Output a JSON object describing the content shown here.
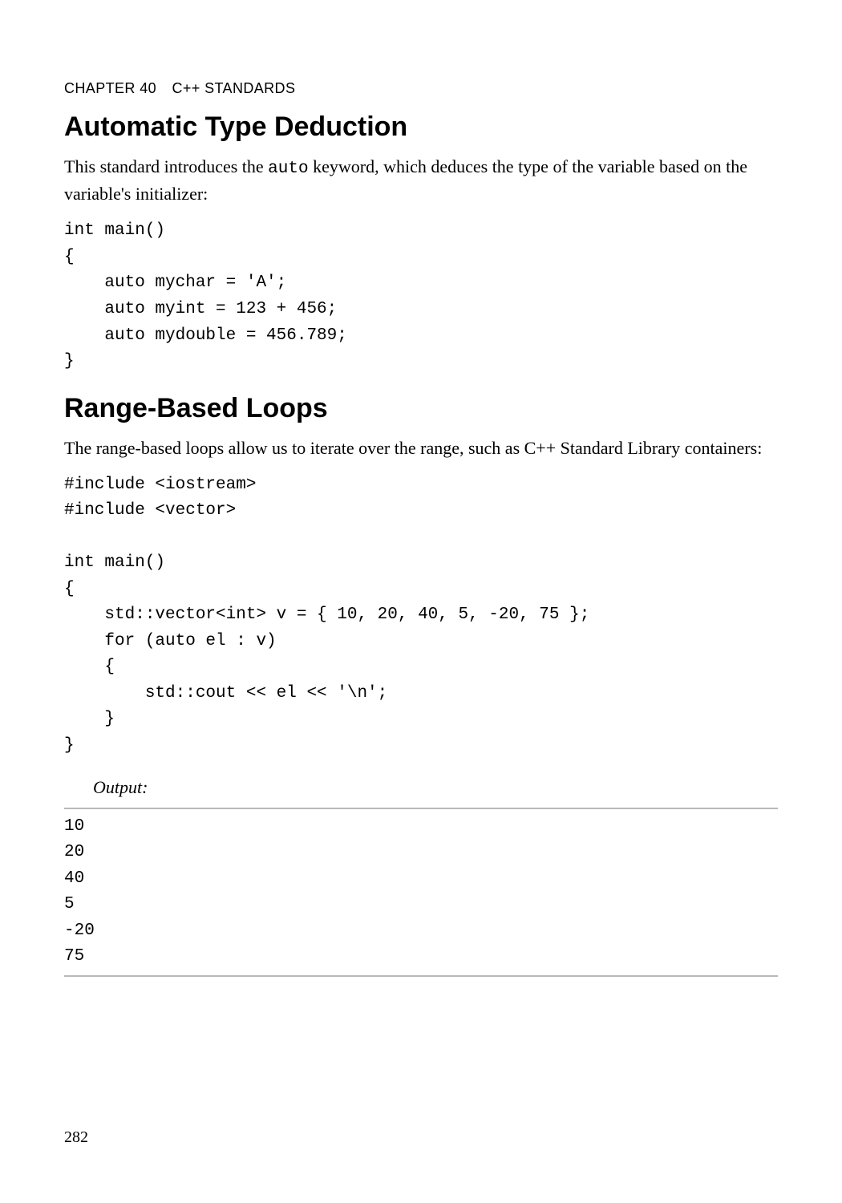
{
  "header": {
    "chapter_label": "CHAPTER 40",
    "chapter_title": "C++ STANDARDS"
  },
  "sections": {
    "s1": {
      "title": "Automatic Type Deduction",
      "intro_pre": "This standard introduces the ",
      "intro_code": "auto",
      "intro_post": " keyword, which deduces the type of the variable based on the variable's initializer:",
      "code": "int main()\n{\n    auto mychar = 'A';\n    auto myint = 123 + 456;\n    auto mydouble = 456.789;\n}"
    },
    "s2": {
      "title": "Range-Based Loops",
      "intro": "The range-based loops allow us to iterate over the range, such as C++ Standard Library containers:",
      "code": "#include <iostream>\n#include <vector>\n\nint main()\n{\n    std::vector<int> v = { 10, 20, 40, 5, -20, 75 };\n    for (auto el : v)\n    {\n        std::cout << el << '\\n';\n    }\n}",
      "output_label": "Output:",
      "output": "10\n20\n40\n5\n-20\n75"
    }
  },
  "page_number": "282"
}
